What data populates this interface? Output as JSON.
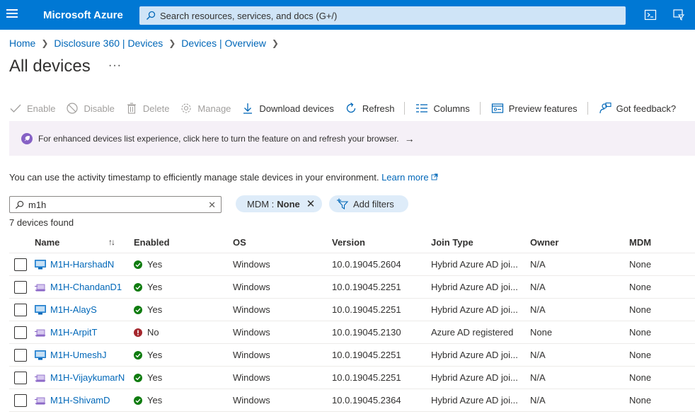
{
  "topbar": {
    "brand": "Microsoft Azure",
    "search_placeholder": "Search resources, services, and docs (G+/)",
    "bg_color": "#0078d4"
  },
  "breadcrumb": [
    "Home",
    "Disclosure 360 | Devices",
    "Devices | Overview"
  ],
  "page": {
    "title": "All devices",
    "more": "···"
  },
  "toolbar": {
    "enable": "Enable",
    "disable": "Disable",
    "delete": "Delete",
    "manage": "Manage",
    "download": "Download devices",
    "refresh": "Refresh",
    "columns": "Columns",
    "preview": "Preview features",
    "feedback": "Got feedback?"
  },
  "banner": {
    "text": "For enhanced devices list experience, click here to turn the feature on and refresh your browser.",
    "arrow": "→"
  },
  "info": {
    "text": "You can use the activity timestamp to efficiently manage stale devices in your environment.",
    "link": "Learn more"
  },
  "filter": {
    "value": "m1h",
    "mdm_label": "MDM :",
    "mdm_value": "None",
    "add_filters": "Add filters"
  },
  "count": "7 devices found",
  "columns": {
    "name": "Name",
    "enabled": "Enabled",
    "os": "OS",
    "version": "Version",
    "join_type": "Join Type",
    "owner": "Owner",
    "mdm": "MDM"
  },
  "devices": [
    {
      "name": "M1H-HarshadN",
      "icon": "desktop-icon",
      "enabled": "Yes",
      "os": "Windows",
      "version": "10.0.19045.2604",
      "join_type": "Hybrid Azure AD joi...",
      "owner": "N/A",
      "mdm": "None"
    },
    {
      "name": "M1H-ChandanD1",
      "icon": "laptop-icon",
      "enabled": "Yes",
      "os": "Windows",
      "version": "10.0.19045.2251",
      "join_type": "Hybrid Azure AD joi...",
      "owner": "N/A",
      "mdm": "None"
    },
    {
      "name": "M1H-AlayS",
      "icon": "desktop-icon",
      "enabled": "Yes",
      "os": "Windows",
      "version": "10.0.19045.2251",
      "join_type": "Hybrid Azure AD joi...",
      "owner": "N/A",
      "mdm": "None"
    },
    {
      "name": "M1H-ArpitT",
      "icon": "laptop-icon",
      "enabled": "No",
      "os": "Windows",
      "version": "10.0.19045.2130",
      "join_type": "Azure AD registered",
      "owner": "None",
      "mdm": "None"
    },
    {
      "name": "M1H-UmeshJ",
      "icon": "desktop-icon",
      "enabled": "Yes",
      "os": "Windows",
      "version": "10.0.19045.2251",
      "join_type": "Hybrid Azure AD joi...",
      "owner": "N/A",
      "mdm": "None"
    },
    {
      "name": "M1H-VijaykumarN",
      "icon": "laptop-icon",
      "enabled": "Yes",
      "os": "Windows",
      "version": "10.0.19045.2251",
      "join_type": "Hybrid Azure AD joi...",
      "owner": "N/A",
      "mdm": "None"
    },
    {
      "name": "M1H-ShivamD",
      "icon": "laptop-icon",
      "enabled": "Yes",
      "os": "Windows",
      "version": "10.0.19045.2364",
      "join_type": "Hybrid Azure AD joi...",
      "owner": "N/A",
      "mdm": "None"
    }
  ],
  "colors": {
    "link": "#0067b8",
    "enabled_yes": "#107c10",
    "enabled_no": "#a4262c",
    "banner_icon": "#8661c5"
  }
}
